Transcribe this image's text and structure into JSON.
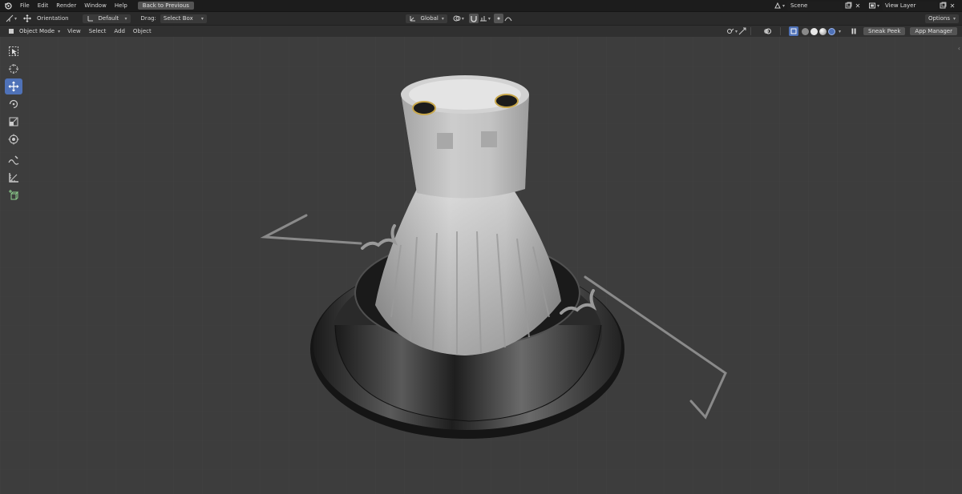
{
  "menubar": {
    "items": [
      "File",
      "Edit",
      "Render",
      "Window",
      "Help"
    ],
    "back_button": "Back to Previous",
    "scene_name": "Scene",
    "view_layer": "View Layer"
  },
  "tool_header": {
    "orientation_label": "Orientation",
    "orientation_value": "Default",
    "drag_label": "Drag:",
    "drag_value": "Select Box",
    "transform_orientation": "Global",
    "options_label": "Options"
  },
  "view_header": {
    "mode": "Object Mode",
    "menus": [
      "View",
      "Select",
      "Add",
      "Object"
    ],
    "sneak_peek": "Sneak Peek",
    "app_manager": "App Manager"
  },
  "toolbar": {
    "tools": [
      {
        "name": "select-box-tool",
        "icon": "cursor-box-icon",
        "active": false
      },
      {
        "name": "cursor-tool",
        "icon": "crosshair-circle-icon",
        "active": false
      },
      {
        "name": "move-tool",
        "icon": "move-arrows-icon",
        "active": true
      },
      {
        "name": "rotate-tool",
        "icon": "rotate-icon",
        "active": false
      },
      {
        "name": "scale-tool",
        "icon": "scale-icon",
        "active": false
      },
      {
        "name": "transform-tool",
        "icon": "transform-icon",
        "active": false
      },
      {
        "name": "annotate-tool",
        "icon": "pencil-curve-icon",
        "active": false
      },
      {
        "name": "measure-tool",
        "icon": "ruler-icon",
        "active": false
      },
      {
        "name": "add-cube-tool",
        "icon": "add-cube-icon",
        "active": false
      }
    ]
  },
  "colors": {
    "accent": "#4f72b8",
    "viewport_bg": "#3d3d3d",
    "header_bg": "#2a2a2a"
  }
}
